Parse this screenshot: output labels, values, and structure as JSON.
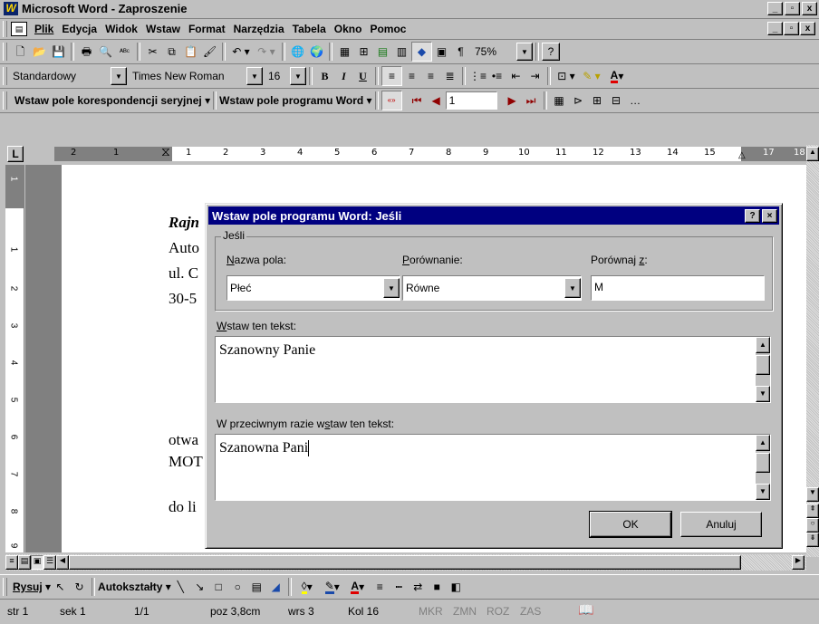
{
  "window": {
    "title": "Microsoft Word - Zaproszenie",
    "app_icon": "W"
  },
  "menu": {
    "items": [
      {
        "label": "Plik"
      },
      {
        "label": "Edycja"
      },
      {
        "label": "Widok"
      },
      {
        "label": "Wstaw"
      },
      {
        "label": "Format"
      },
      {
        "label": "Narzędzia"
      },
      {
        "label": "Tabela"
      },
      {
        "label": "Okno"
      },
      {
        "label": "Pomoc"
      }
    ]
  },
  "standard_toolbar": {
    "zoom": "75%",
    "icons": [
      "new-icon",
      "open-icon",
      "save-icon",
      "print-icon",
      "print-preview-icon",
      "spelling-icon",
      "cut-icon",
      "copy-icon",
      "paste-icon",
      "format-painter-icon",
      "undo-icon",
      "redo-icon",
      "web-toolbar-icon",
      "hyperlink-icon",
      "tables-borders-icon",
      "insert-table-icon",
      "insert-excel-icon",
      "columns-icon",
      "drawing-icon",
      "document-map-icon",
      "show-paragraph-icon",
      "help-icon"
    ]
  },
  "formatting_toolbar": {
    "style": "Standardowy",
    "font": "Times New Roman",
    "size": "16",
    "bold": "B",
    "italic": "I",
    "underline": "U"
  },
  "mailmerge_toolbar": {
    "insert_merge_field": "Wstaw pole korespondencji seryjnej",
    "insert_word_field": "Wstaw pole programu Word",
    "record": "1"
  },
  "ruler": {
    "left_numbers": [
      "2",
      "1"
    ],
    "numbers": [
      "1",
      "2",
      "3",
      "4",
      "5",
      "6",
      "7",
      "8",
      "9",
      "10",
      "11",
      "12",
      "13",
      "14",
      "15",
      "17",
      "18"
    ],
    "vertical_numbers": [
      "1",
      "1",
      "2",
      "3",
      "4",
      "5",
      "6",
      "7",
      "8",
      "9"
    ]
  },
  "document": {
    "lines": [
      {
        "text": "Rajn"
      },
      {
        "text": "Auto"
      },
      {
        "text": "ul. C"
      },
      {
        "text": "30-5"
      },
      {
        "text": "otwa"
      },
      {
        "text": "MOT"
      },
      {
        "text": "do li"
      }
    ]
  },
  "dialog": {
    "title": "Wstaw pole programu Word: Jeśli",
    "help_btn": "?",
    "close_btn": "×",
    "group_label": "Jeśli",
    "field_name_label": "Nazwa pola:",
    "field_name_value": "Płeć",
    "comparison_label": "Porównanie:",
    "comparison_value": "Równe",
    "compare_to_label": "Porównaj z:",
    "compare_to_value": "M",
    "insert_text_label": "Wstaw ten tekst:",
    "insert_text_value": "Szanowny Panie",
    "otherwise_label": "W przeciwnym razie wstaw ten tekst:",
    "otherwise_value": "Szanowna Pani",
    "ok": "OK",
    "cancel": "Anuluj"
  },
  "drawing_toolbar": {
    "draw": "Rysuj",
    "autoshapes": "Autokształty"
  },
  "status_bar": {
    "page": "str 1",
    "section": "sek 1",
    "pages": "1/1",
    "position": "poz 3,8cm",
    "line": "wrs 3",
    "column": "Kol 16",
    "mkr": "MKR",
    "zmn": "ZMN",
    "roz": "ROZ",
    "zas": "ZAS"
  }
}
